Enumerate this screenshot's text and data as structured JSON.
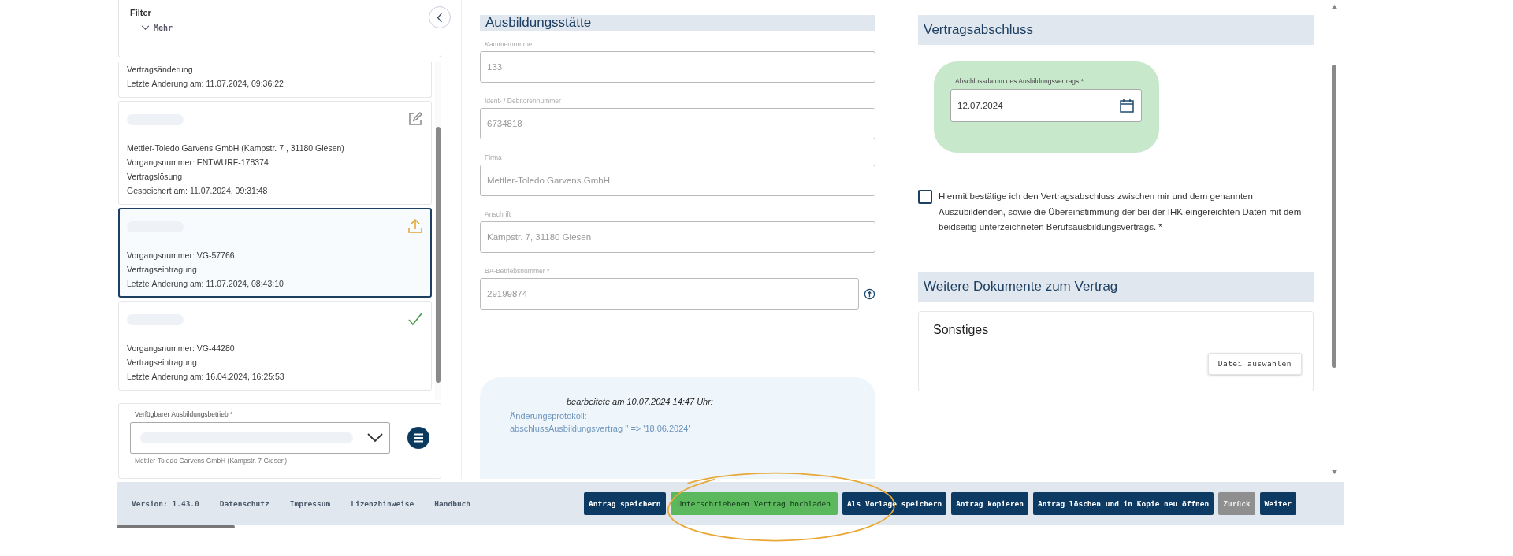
{
  "sidebar": {
    "filter": {
      "title": "Filter",
      "more": "Mehr"
    },
    "cards": [
      {
        "selected": false,
        "cut": true,
        "lines": [
          "Vertragsänderung",
          "Letzte Änderung am: 11.07.2024, 09:36:22"
        ]
      },
      {
        "kind": "edit",
        "selected": false,
        "cut": false,
        "redacted": true,
        "lines": [
          "Mettler-Toledo Garvens GmbH (Kampstr. 7 , 31180 Giesen)",
          "Vorgangsnummer: ENTWURF-178374",
          "Vertragslösung",
          "Gespeichert am: 11.07.2024, 09:31:48"
        ]
      },
      {
        "kind": "upload",
        "selected": true,
        "cut": false,
        "redacted": true,
        "lines": [
          "Vorgangsnummer: VG-57766",
          "Vertragseintragung",
          "Letzte Änderung am: 11.07.2024, 08:43:10"
        ]
      },
      {
        "kind": "check",
        "selected": false,
        "cut": false,
        "redacted": true,
        "lines": [
          "Vorgangsnummer: VG-44280",
          "Vertragseintragung",
          "Letzte Änderung am: 16.04.2024, 16:25:53"
        ]
      }
    ],
    "company_select": {
      "label": "Verfügbarer Ausbildungsbetrieb *",
      "hint": "Mettler-Toledo Garvens GmbH (Kampstr. 7 Giesen)"
    }
  },
  "ausbildungsstaette": {
    "title": "Ausbildungsstätte",
    "fields": [
      {
        "label": "Kammernummer",
        "value": "133",
        "info": false
      },
      {
        "label": "Ident- / Debitorennummer",
        "value": "6734818",
        "info": false
      },
      {
        "label": "Firma",
        "value": "Mettler-Toledo Garvens GmbH",
        "info": false
      },
      {
        "label": "Anschrift",
        "value": "Kampstr. 7, 31180 Giesen",
        "info": false
      },
      {
        "label": "BA-Betriebsnummer *",
        "value": "29199874",
        "info": true
      }
    ]
  },
  "change_log": {
    "heading": "bearbeitete am 10.07.2024 14:47 Uhr:",
    "lines": [
      "Änderungsprotokoll:",
      "abschlussAusbildungsvertrag '' => '18.06.2024'"
    ]
  },
  "vertragsabschluss": {
    "title": "Vertragsabschluss",
    "date_label": "Abschlussdatum des Ausbildungsvertrags *",
    "date_value": "12.07.2024",
    "confirm": {
      "checked": false,
      "text": "Hiermit bestätige ich den Vertragsabschluss zwischen mir und dem genannten Auszubildenden, sowie die Übereinstimmung der bei der IHK eingereichten Daten mit dem beidseitig unterzeichneten Berufsausbildungsvertrags. *"
    }
  },
  "documents": {
    "title": "Weitere Dokumente zum Vertrag",
    "card_title": "Sonstiges",
    "button": "Datei auswählen"
  },
  "footer": {
    "version": "Version: 1.43.0",
    "links": [
      "Datenschutz",
      "Impressum",
      "Lizenzhinweise",
      "Handbuch"
    ],
    "buttons": [
      {
        "label": "Antrag speichern",
        "kind": "primary",
        "disabled": false
      },
      {
        "label": "Unterschriebenen Vertrag hochladen",
        "kind": "success",
        "disabled": false
      },
      {
        "label": "Als Vorlage speichern",
        "kind": "primary",
        "disabled": false
      },
      {
        "label": "Antrag kopieren",
        "kind": "primary",
        "disabled": false
      },
      {
        "label": "Antrag löschen und in Kopie neu öffnen",
        "kind": "primary",
        "disabled": false
      },
      {
        "label": "Zurück",
        "kind": "primary",
        "disabled": true
      },
      {
        "label": "Weiter",
        "kind": "primary",
        "disabled": false
      }
    ]
  }
}
